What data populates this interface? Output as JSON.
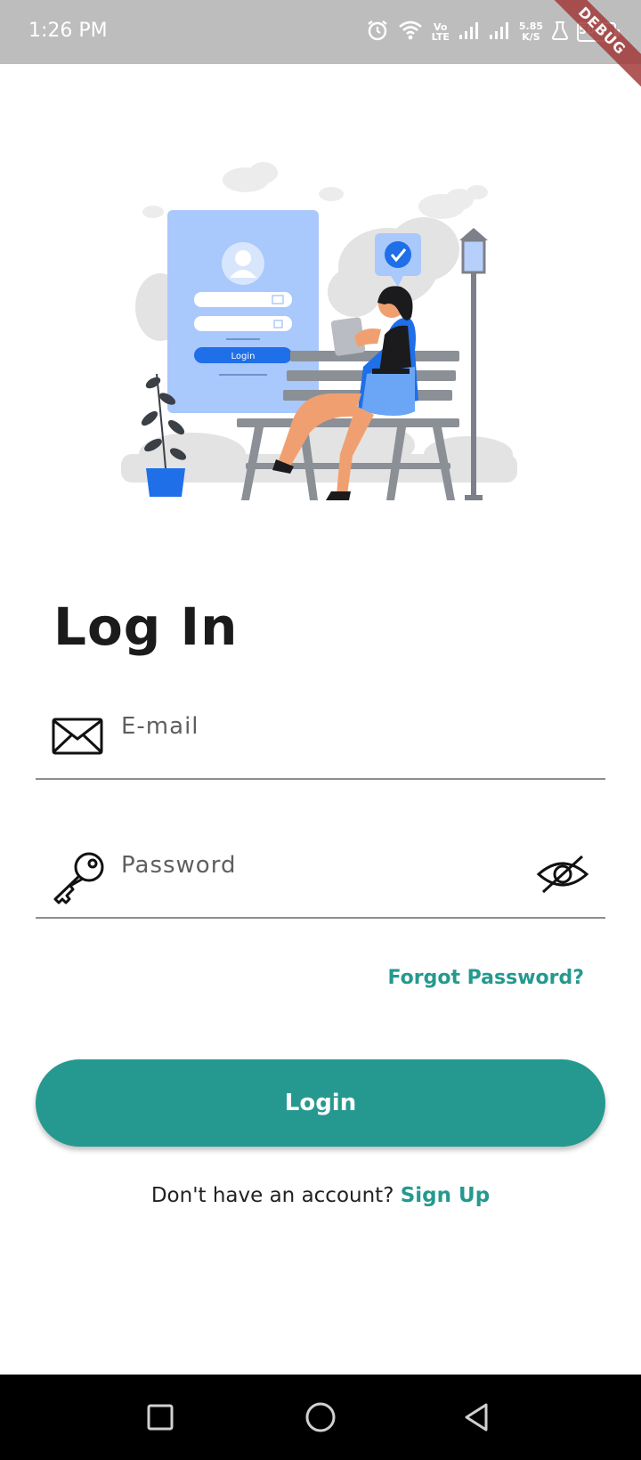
{
  "status_bar": {
    "time": "1:26 PM",
    "volte_label": "Vo\nLTE",
    "net_speed": "5.85",
    "net_speed_unit": "K/S",
    "battery_level": "50",
    "icons": [
      "alarm-icon",
      "wifi-icon",
      "volte-icon",
      "signal-icon",
      "signal-icon",
      "lab-icon",
      "battery-icon"
    ]
  },
  "debug_banner": "DEBUG",
  "illustration": {
    "form_login_label": "Login"
  },
  "page": {
    "title": "Log In"
  },
  "email_field": {
    "placeholder": "E-mail",
    "value": "",
    "icon": "mail-icon"
  },
  "password_field": {
    "placeholder": "Password",
    "value": "",
    "icon": "key-icon",
    "toggle_icon": "eye-off-icon"
  },
  "forgot_password_label": "Forgot Password?",
  "login_button_label": "Login",
  "signup": {
    "prompt": "Don't have an account? ",
    "link_label": "Sign Up"
  },
  "colors": {
    "accent": "#25998f",
    "status_bar": "#bdbdbd",
    "illustration_blue": "#2f7bf0",
    "nav_bar": "#000000"
  },
  "nav_bar": {
    "buttons": [
      "recent-apps-icon",
      "home-icon",
      "back-icon"
    ]
  }
}
